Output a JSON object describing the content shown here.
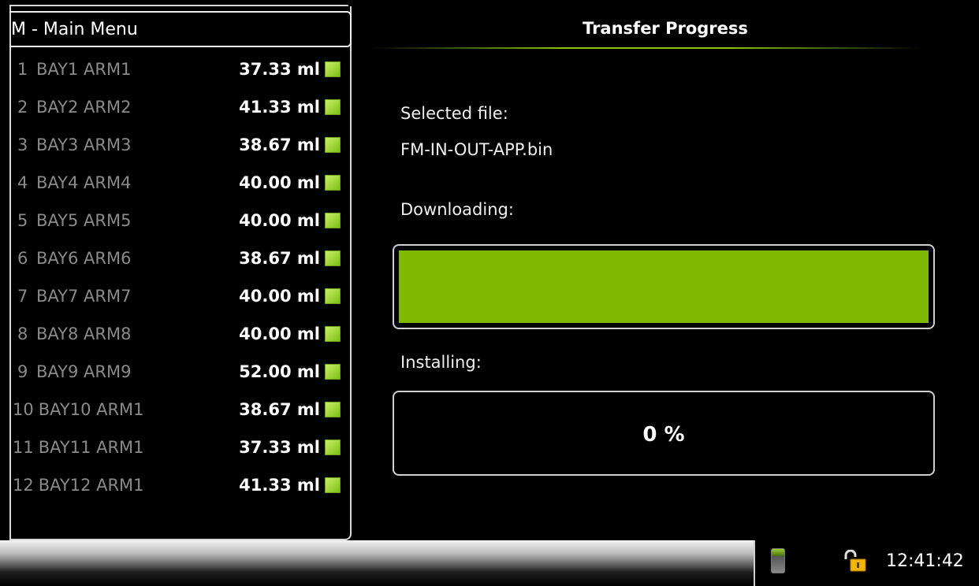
{
  "menu": {
    "title": "M - Main Menu",
    "items": [
      {
        "num": "1",
        "name": "BAY1 ARM1",
        "volume": "37.33 ml"
      },
      {
        "num": "2",
        "name": "BAY2 ARM2",
        "volume": "41.33 ml"
      },
      {
        "num": "3",
        "name": "BAY3 ARM3",
        "volume": "38.67 ml"
      },
      {
        "num": "4",
        "name": "BAY4 ARM4",
        "volume": "40.00 ml"
      },
      {
        "num": "5",
        "name": "BAY5 ARM5",
        "volume": "40.00 ml"
      },
      {
        "num": "6",
        "name": "BAY6 ARM6",
        "volume": "38.67 ml"
      },
      {
        "num": "7",
        "name": "BAY7 ARM7",
        "volume": "40.00 ml"
      },
      {
        "num": "8",
        "name": "BAY8 ARM8",
        "volume": "40.00 ml"
      },
      {
        "num": "9",
        "name": "BAY9 ARM9",
        "volume": "52.00 ml"
      },
      {
        "num": "10",
        "name": "BAY10 ARM1",
        "volume": "38.67 ml"
      },
      {
        "num": "11",
        "name": "BAY11 ARM1",
        "volume": "37.33 ml"
      },
      {
        "num": "12",
        "name": "BAY12 ARM1",
        "volume": "41.33 ml"
      }
    ]
  },
  "panel": {
    "title": "Transfer Progress",
    "selected_file_label": "Selected file:",
    "selected_file": "FM-IN-OUT-APP.bin",
    "downloading_label": "Downloading:",
    "downloading_progress": 1.0,
    "installing_label": "Installing:",
    "installing_text": "0 %",
    "installing_progress": 0
  },
  "status": {
    "time": "12:41:42",
    "device_icon": "handheld-device-icon",
    "lock_icon": "unlocked-padlock-icon"
  },
  "colors": {
    "accent": "#80b800",
    "led": "#9ad420"
  }
}
